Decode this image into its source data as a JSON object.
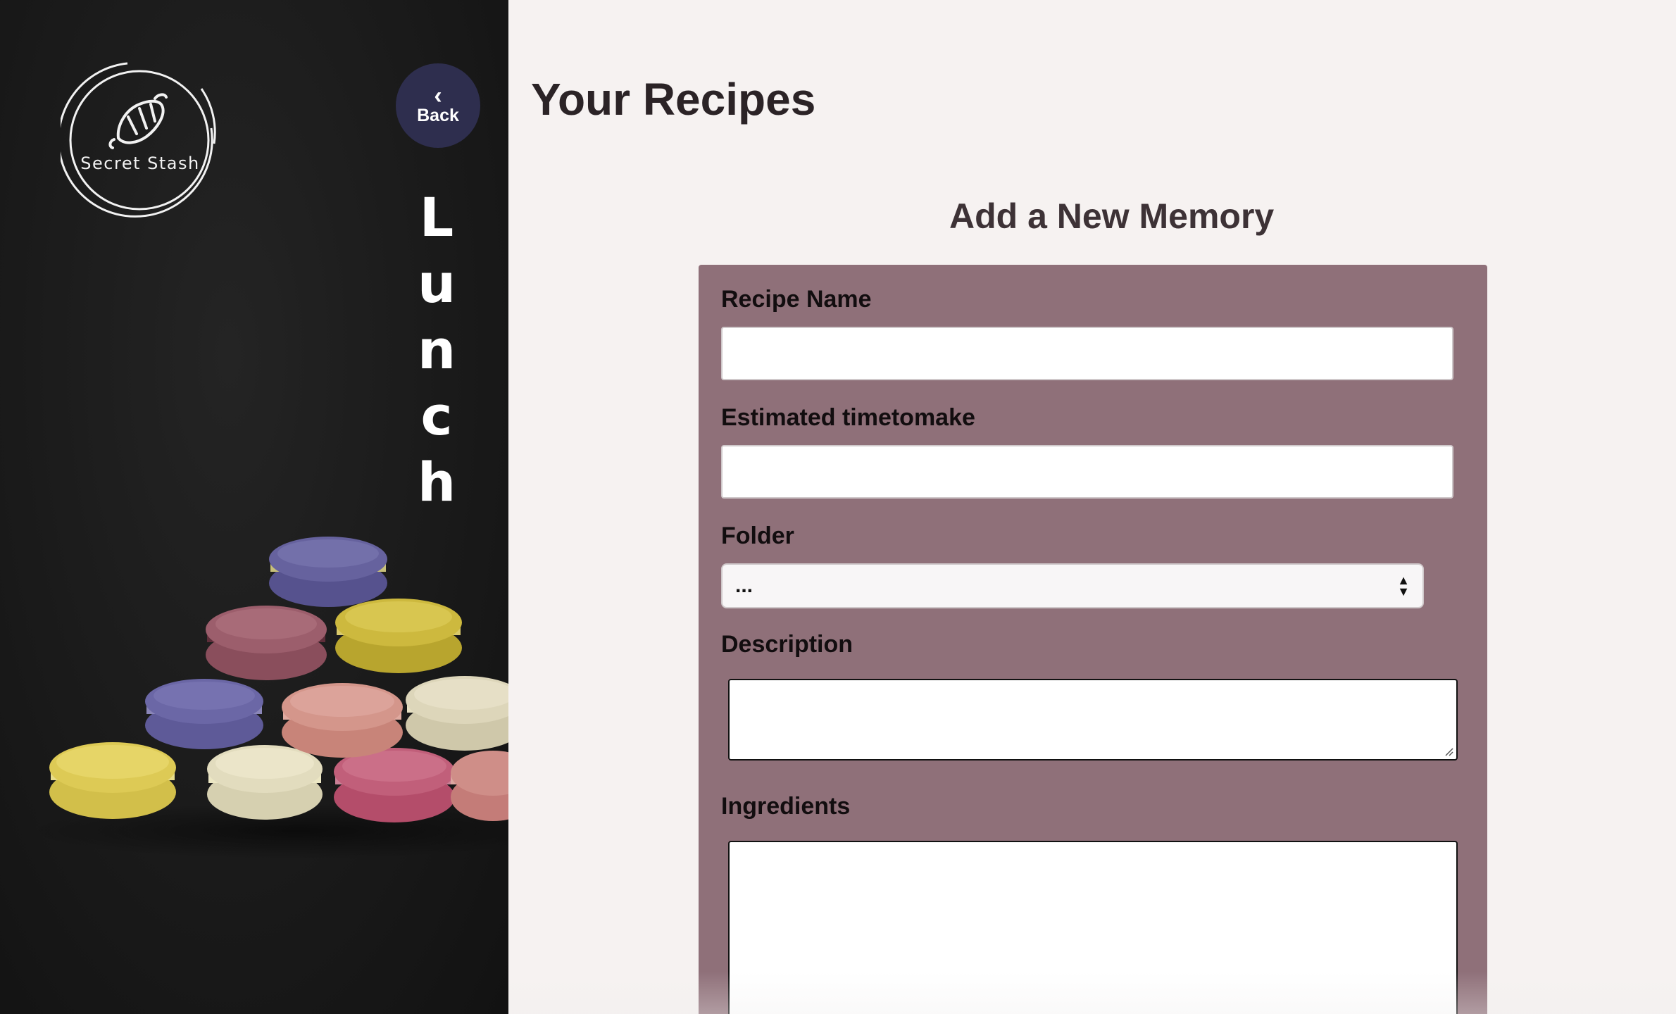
{
  "sidebar": {
    "logo_text": "Secret Stash",
    "back_label": "Back",
    "category_letters": [
      "L",
      "u",
      "n",
      "c",
      "h"
    ]
  },
  "main": {
    "page_title": "Your Recipes",
    "form_heading": "Add a New Memory",
    "fields": {
      "recipe_name_label": "Recipe Name",
      "recipe_name_value": "",
      "time_label": "Estimated timetomake",
      "time_value": "",
      "folder_label": "Folder",
      "folder_selected": "...",
      "description_label": "Description",
      "ingredients_label": "Ingredients"
    }
  },
  "colors": {
    "sidebar_bg": "#1a1a1a",
    "back_button_bg": "#2e2e4e",
    "page_bg": "#f6f2f1",
    "form_card_bg": "#8f7079",
    "title_text": "#2b2326"
  },
  "icons": {
    "logo": "croissant-icon",
    "back": "chevron-left-icon",
    "select": "select-arrows-icon"
  }
}
